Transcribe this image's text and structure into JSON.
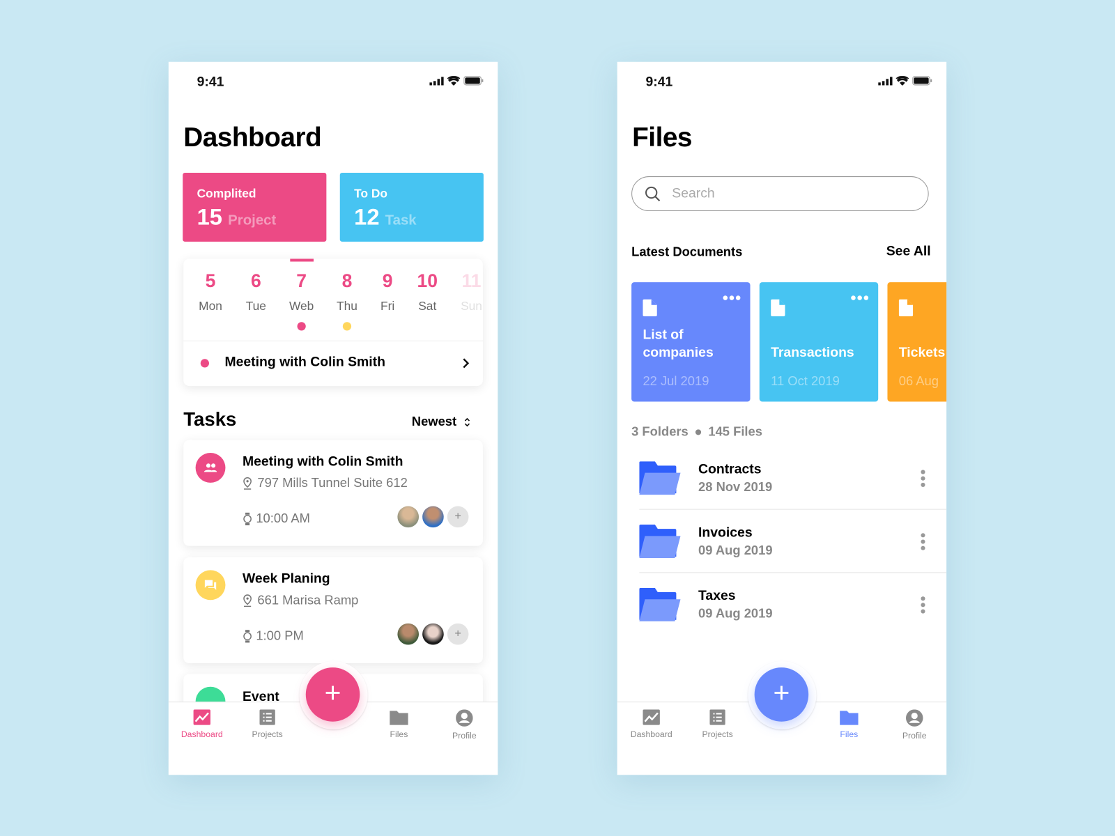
{
  "colors": {
    "pink": "#ec4a85",
    "blue": "#47c4f2",
    "yellow": "#ffd65c",
    "green": "#3ddc97",
    "indigo": "#6788fc",
    "orange": "#fea623",
    "background": "#c9e8f3"
  },
  "dashboard": {
    "status_time": "9:41",
    "title": "Dashboard",
    "stats": [
      {
        "label": "Complited",
        "value": "15",
        "unit": "Project"
      },
      {
        "label": "To Do",
        "value": "12",
        "unit": "Task"
      }
    ],
    "calendar": {
      "days": [
        {
          "num": "5",
          "day": "Mon"
        },
        {
          "num": "6",
          "day": "Tue"
        },
        {
          "num": "7",
          "day": "Web",
          "selected": true,
          "dot": "pink"
        },
        {
          "num": "8",
          "day": "Thu",
          "dot": "yellow"
        },
        {
          "num": "9",
          "day": "Fri"
        },
        {
          "num": "10",
          "day": "Sat"
        },
        {
          "num": "11",
          "day": "Sun"
        }
      ],
      "event": "Meeting with Colin Smith"
    },
    "tasks_title": "Tasks",
    "sort": "Newest",
    "tasks": [
      {
        "title": "Meeting with Colin Smith",
        "address": "797 Mills Tunnel Suite 612",
        "time": "10:00 AM",
        "icon": "people-icon"
      },
      {
        "title": "Week Planing",
        "address": "661 Marisa Ramp",
        "time": "1:00 PM",
        "icon": "chat-icon"
      },
      {
        "title": "Event",
        "icon": "calendar-icon"
      }
    ],
    "nav": [
      {
        "label": "Dashboard",
        "icon": "chart-icon",
        "active": true
      },
      {
        "label": "Projects",
        "icon": "list-icon"
      },
      {
        "label": "Files",
        "icon": "folder-icon"
      },
      {
        "label": "Profile",
        "icon": "user-icon"
      }
    ],
    "fab": "+"
  },
  "files": {
    "status_time": "9:41",
    "title": "Files",
    "search_placeholder": "Search",
    "latest_title": "Latest Documents",
    "see_all": "See All",
    "documents": [
      {
        "title": "List of companies",
        "date": "22 Jul 2019"
      },
      {
        "title": "Transactions",
        "date": "11 Oct 2019"
      },
      {
        "title": "Tickets",
        "date": "06 Aug"
      }
    ],
    "summary": {
      "folders": "3 Folders",
      "files": "145 Files"
    },
    "folders": [
      {
        "name": "Contracts",
        "date": "28 Nov 2019"
      },
      {
        "name": "Invoices",
        "date": "09 Aug 2019"
      },
      {
        "name": "Taxes",
        "date": "09 Aug 2019"
      }
    ],
    "nav": [
      {
        "label": "Dashboard",
        "icon": "chart-icon"
      },
      {
        "label": "Projects",
        "icon": "list-icon"
      },
      {
        "label": "Files",
        "icon": "folder-icon",
        "active": true
      },
      {
        "label": "Profile",
        "icon": "user-icon"
      }
    ],
    "fab": "+"
  }
}
